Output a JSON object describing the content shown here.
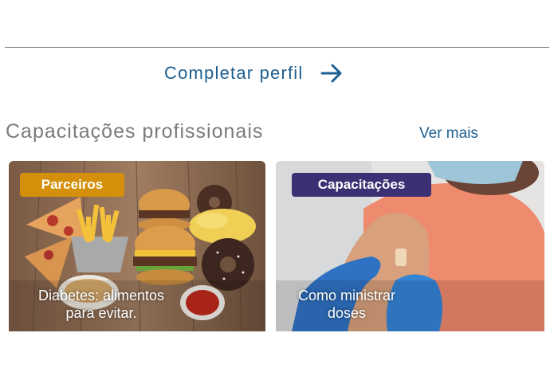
{
  "profile_link": {
    "label": "Completar perfil",
    "icon": "arrow-right-icon",
    "color": "#1d5f91"
  },
  "section": {
    "title": "Capacitações profissionais",
    "see_more": "Ver mais"
  },
  "cards": [
    {
      "badge": "Parceiros",
      "badge_color": "#d4900b",
      "caption_line1": "Diabetes: alimentos",
      "caption_line2": "para evitar.",
      "image": "fast-food-image"
    },
    {
      "badge": "Capacitações",
      "badge_color": "#3d2f74",
      "caption_line1": "Como ministrar",
      "caption_line2": "doses",
      "image": "vaccination-image"
    }
  ]
}
